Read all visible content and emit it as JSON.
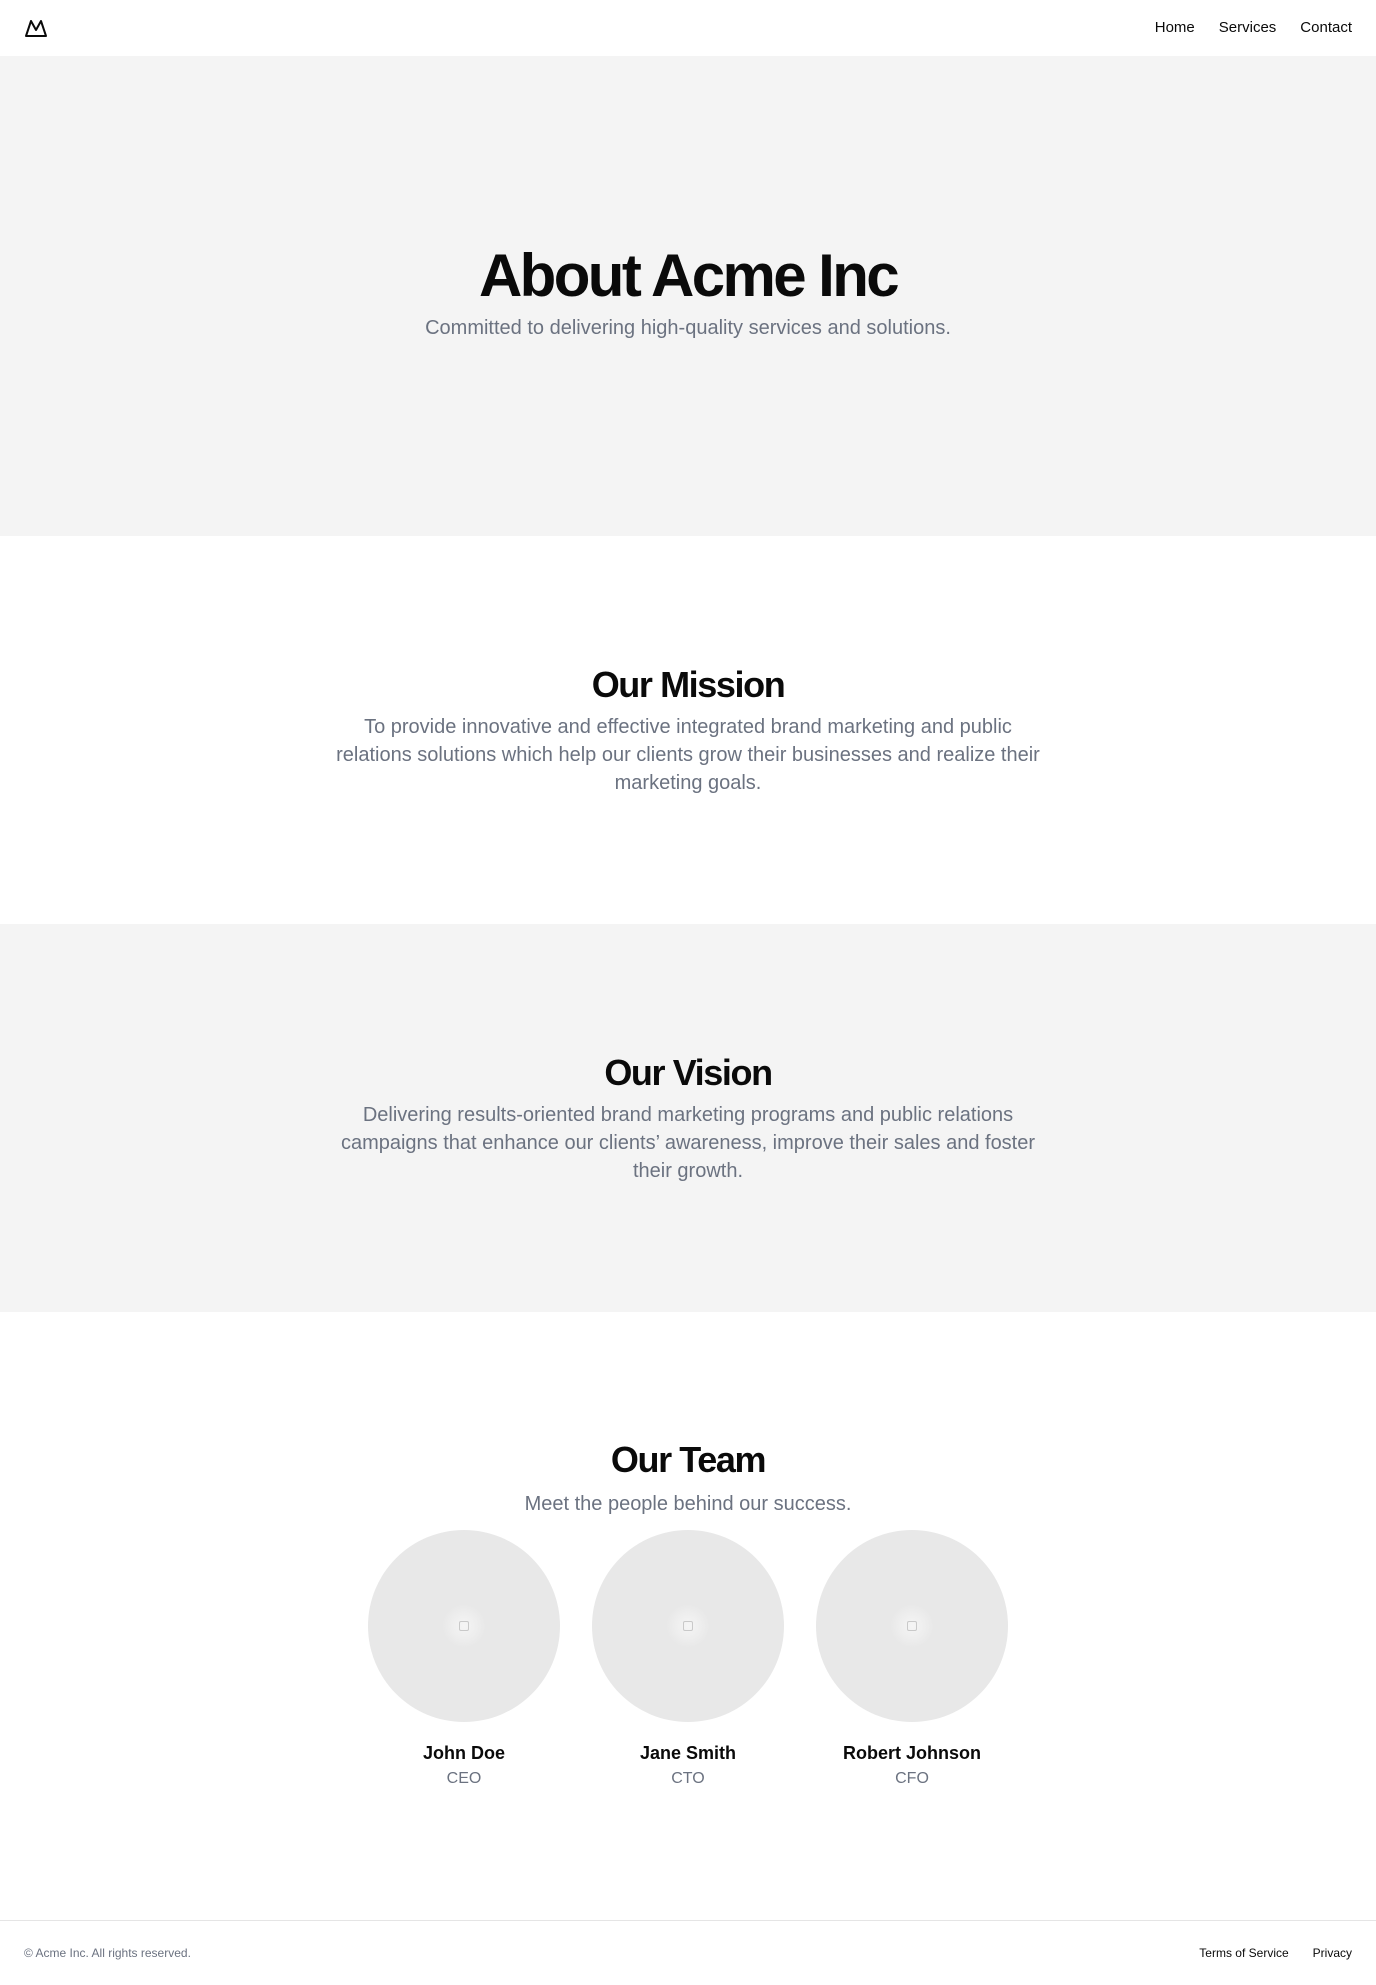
{
  "header": {
    "logo_icon": "mountain-icon",
    "nav": [
      {
        "label": "Home"
      },
      {
        "label": "Services"
      },
      {
        "label": "Contact"
      }
    ]
  },
  "hero": {
    "title": "About Acme Inc",
    "subtitle": "Committed to delivering high-quality services and solutions."
  },
  "mission": {
    "title": "Our Mission",
    "text": "To provide innovative and effective integrated brand marketing and public relations solutions which help our clients grow their businesses and realize their marketing goals."
  },
  "vision": {
    "title": "Our Vision",
    "text": "Delivering results-oriented brand marketing programs and public relations campaigns that enhance our clients’ awareness, improve their sales and foster their growth."
  },
  "team": {
    "title": "Our Team",
    "subtitle": "Meet the people behind our success.",
    "members": [
      {
        "name": "John Doe",
        "role": "CEO"
      },
      {
        "name": "Jane Smith",
        "role": "CTO"
      },
      {
        "name": "Robert Johnson",
        "role": "CFO"
      }
    ]
  },
  "footer": {
    "copyright": "© Acme Inc. All rights reserved.",
    "links": [
      {
        "label": "Terms of Service"
      },
      {
        "label": "Privacy"
      }
    ]
  },
  "colors": {
    "text": "#0a0a0a",
    "muted": "#6b7280",
    "section_alt_bg": "#f4f4f4",
    "avatar_bg": "#e8e8e8"
  }
}
